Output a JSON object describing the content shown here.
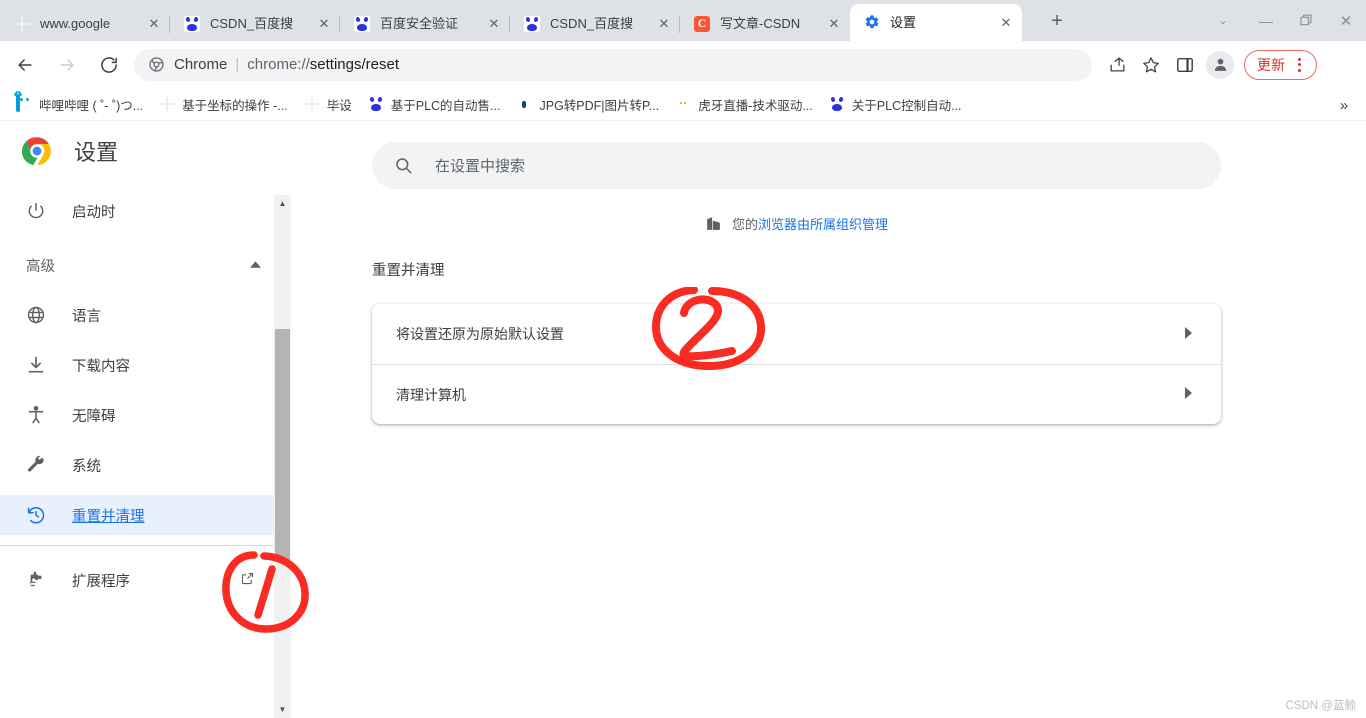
{
  "window": {
    "controls": {
      "tab_search_icon": "chevron-down-icon",
      "minimize": "minimize-icon",
      "maximize": "restore-icon",
      "close": "close-icon"
    }
  },
  "tabs": [
    {
      "title": "www.google",
      "favicon": "globe-icon",
      "active": false
    },
    {
      "title": "CSDN_百度搜",
      "favicon": "baidu-icon",
      "active": false
    },
    {
      "title": "百度安全验证",
      "favicon": "baidu-icon",
      "active": false
    },
    {
      "title": "CSDN_百度搜",
      "favicon": "baidu-icon",
      "active": false
    },
    {
      "title": "写文章-CSDN",
      "favicon": "csdn-icon",
      "active": false
    },
    {
      "title": "设置",
      "favicon": "gear-icon",
      "active": true
    }
  ],
  "newtab_label": "+",
  "toolbar": {
    "back_icon": "arrow-left-icon",
    "forward_icon": "arrow-right-icon",
    "reload_icon": "reload-icon",
    "omnibox": {
      "chrome_label": "Chrome",
      "separator": "|",
      "url_prefix": "chrome://",
      "url_bold": "settings/reset",
      "full_url": "chrome://settings/reset"
    },
    "share_icon": "share-icon",
    "bookmark_icon": "star-icon",
    "sidepanel_icon": "side-panel-icon",
    "profile_icon": "avatar-icon",
    "update_label": "更新",
    "menu_icon": "three-dot-menu-icon",
    "accent_red": "#d93025"
  },
  "bookmarks": [
    {
      "label": "哔哩哔哩 ( ˚- ˚)つ...",
      "favicon": "bilibili-icon"
    },
    {
      "label": "基于坐标的操作 -...",
      "favicon": "globe-icon"
    },
    {
      "label": "毕设",
      "favicon": "globe-icon"
    },
    {
      "label": "基于PLC的自动售...",
      "favicon": "baidu-icon"
    },
    {
      "label": "JPG转PDF|图片转P...",
      "favicon": "jpg-pdf-icon"
    },
    {
      "label": "虎牙直播-技术驱动...",
      "favicon": "huya-icon"
    },
    {
      "label": "关于PLC控制自动...",
      "favicon": "baidu-icon"
    }
  ],
  "bookmarks_overflow_label": "»",
  "sidebar": {
    "brand_title": "设置",
    "brand_logo": "chrome-logo-icon",
    "items": [
      {
        "label": "启动时",
        "icon": "power-icon",
        "selected": false
      },
      {
        "label": "语言",
        "icon": "globe-icon",
        "selected": false
      },
      {
        "label": "下载内容",
        "icon": "download-icon",
        "selected": false
      },
      {
        "label": "无障碍",
        "icon": "accessibility-icon",
        "selected": false
      },
      {
        "label": "系统",
        "icon": "wrench-icon",
        "selected": false
      },
      {
        "label": "重置并清理",
        "icon": "history-reset-icon",
        "selected": true
      },
      {
        "label": "扩展程序",
        "icon": "puzzle-icon",
        "selected": false,
        "external": true
      }
    ],
    "section": {
      "label": "高级",
      "expanded": true,
      "arrow_icon": "chevron-up-icon"
    },
    "external_icon": "open-in-new-icon",
    "scrollbar": {
      "up_arrow": "▲",
      "down_arrow": "▼"
    },
    "selected_bg": "#e8f0fe",
    "selected_fg": "#1a73e8"
  },
  "main": {
    "search": {
      "placeholder": "在设置中搜索",
      "value": "",
      "icon": "search-icon"
    },
    "managed_notice": {
      "icon": "building-icon",
      "prefix": "您的",
      "link_text": "浏览器由所属组织管理"
    },
    "section_title": "重置并清理",
    "rows": [
      {
        "label": "将设置还原为原始默认设置",
        "chevron": "chevron-right-icon"
      },
      {
        "label": "清理计算机",
        "chevron": "chevron-right-icon"
      }
    ]
  },
  "annotations": [
    {
      "id": "1",
      "text": "1",
      "shape": "circle",
      "color": "#fa2b22"
    },
    {
      "id": "2",
      "text": "2",
      "shape": "oval",
      "color": "#fa2b22"
    }
  ],
  "watermark": "CSDN @蓝鲸"
}
